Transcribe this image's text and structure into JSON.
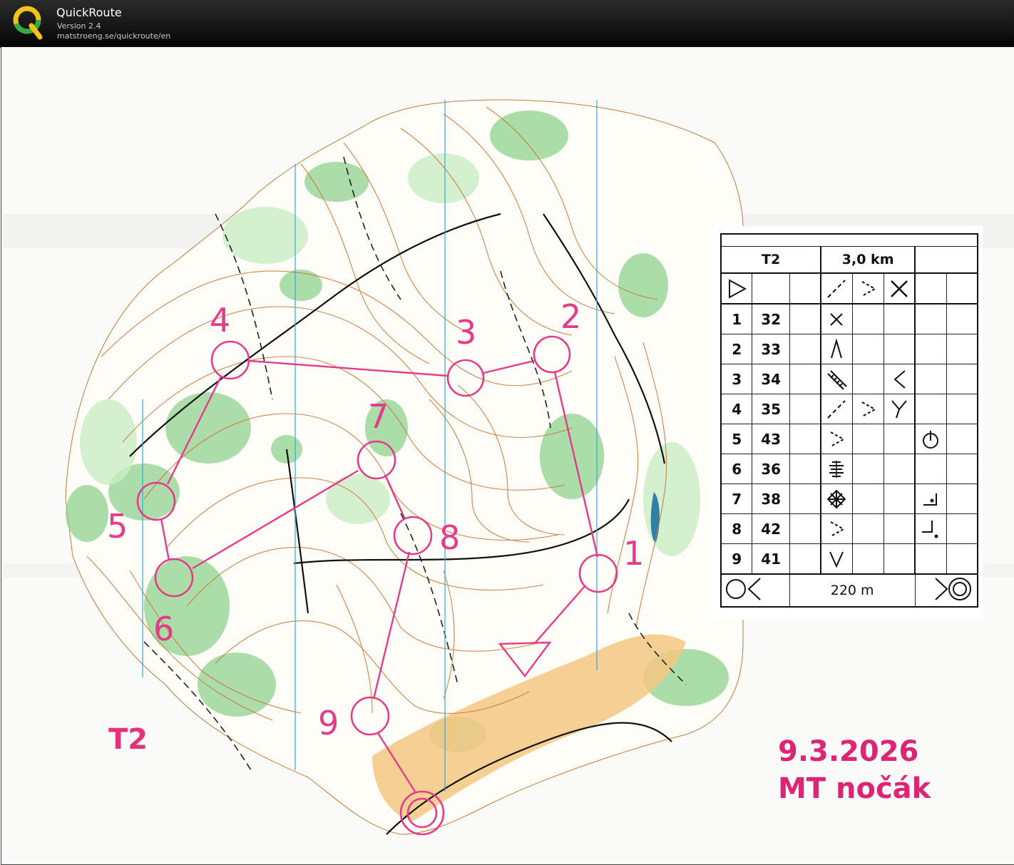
{
  "app": {
    "name": "QuickRoute",
    "version": "Version 2.4",
    "url": "matstroeng.se/quickroute/en"
  },
  "map": {
    "course_label": "T2",
    "date": "9.3.2026",
    "event": "MT nočák",
    "course_color": "#e43c88"
  },
  "control_description": {
    "course": "T2",
    "length": "3,0 km",
    "start_row": {
      "col_c": "",
      "col_d": "path-junction-icon",
      "col_e": "",
      "col_f": "crossing-icon"
    },
    "controls": [
      {
        "number": "1",
        "code": "32",
        "feature_icon": "cross-icon",
        "extra_icon": ""
      },
      {
        "number": "2",
        "code": "33",
        "feature_icon": "spur-icon",
        "extra_icon": ""
      },
      {
        "number": "3",
        "code": "34",
        "feature_icon": "earth-bank-icon",
        "side_icon": "bend-icon",
        "extra_icon": ""
      },
      {
        "number": "4",
        "code": "35",
        "feature_icon": "path-junction-icon",
        "side_icon": "fork-icon",
        "extra_icon": ""
      },
      {
        "number": "5",
        "code": "43",
        "feature_icon": "path-end-icon",
        "extra_icon": "foot-icon"
      },
      {
        "number": "6",
        "code": "36",
        "feature_icon": "marsh-icon",
        "extra_icon": ""
      },
      {
        "number": "7",
        "code": "38",
        "feature_icon": "thicket-icon",
        "extra_icon": "corner-icon"
      },
      {
        "number": "8",
        "code": "42",
        "feature_icon": "path-end-icon",
        "extra_icon": "corner-inside-icon"
      },
      {
        "number": "9",
        "code": "41",
        "feature_icon": "reentrant-icon",
        "extra_icon": ""
      }
    ],
    "finish_distance": "220 m"
  },
  "course_controls": [
    {
      "label": "1"
    },
    {
      "label": "2"
    },
    {
      "label": "3"
    },
    {
      "label": "4"
    },
    {
      "label": "5"
    },
    {
      "label": "6"
    },
    {
      "label": "7"
    },
    {
      "label": "8"
    },
    {
      "label": "9"
    }
  ]
}
